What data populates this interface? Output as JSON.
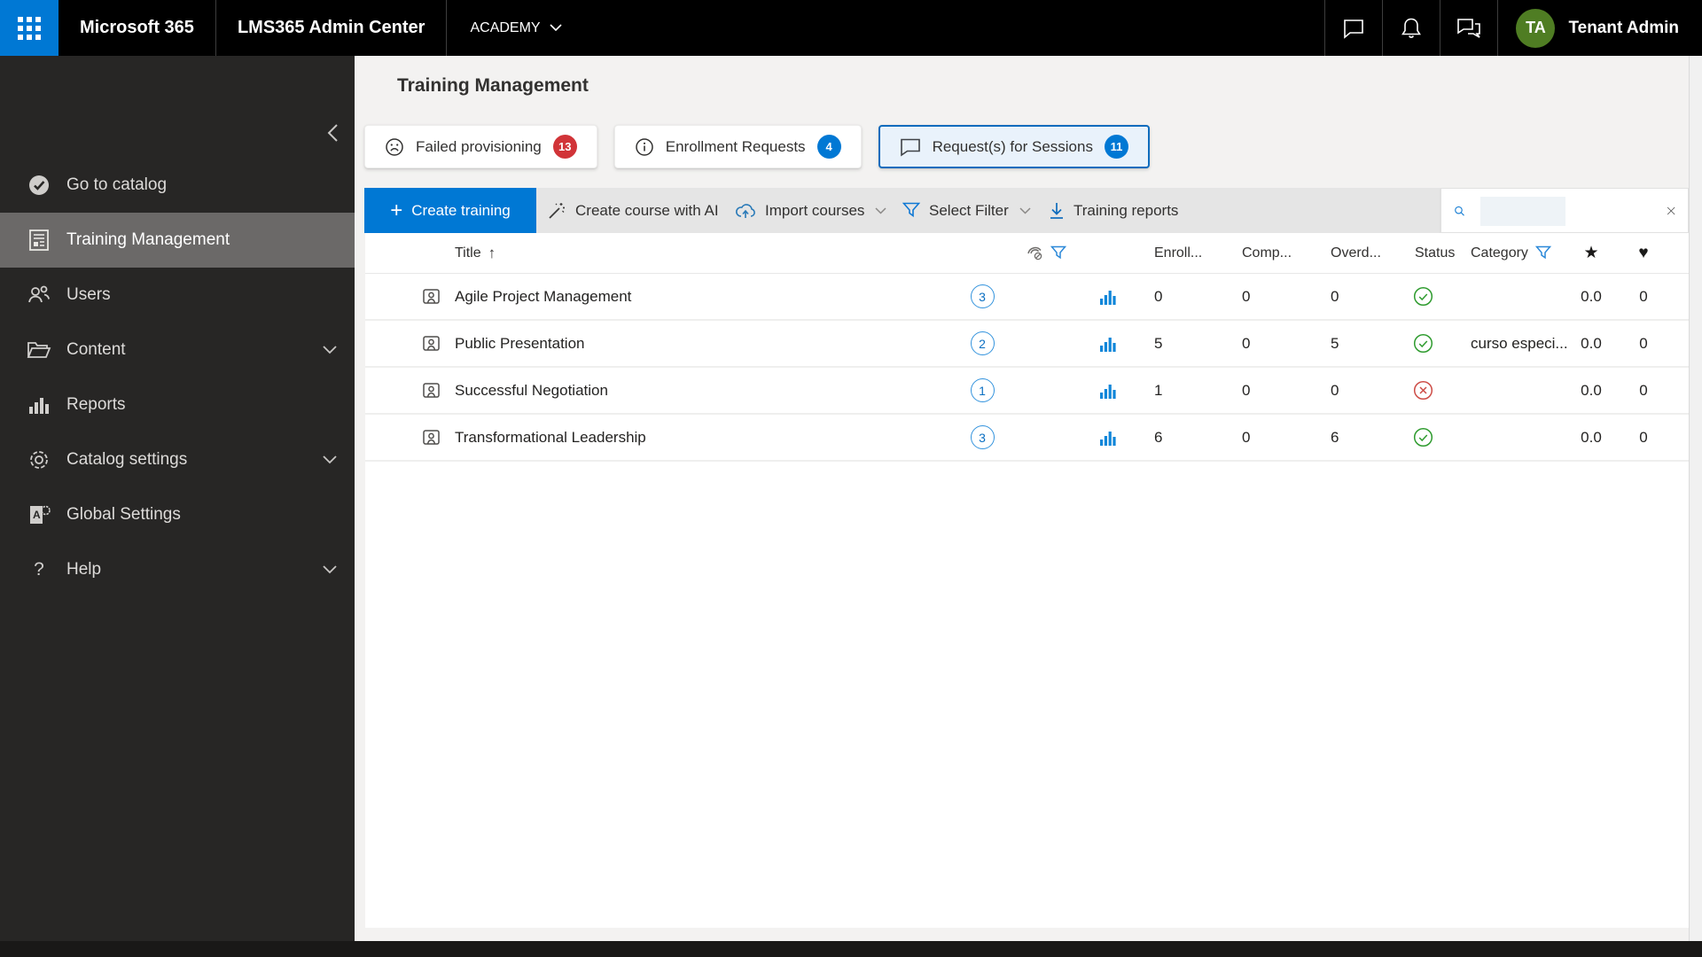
{
  "colors": {
    "accent": "#0078d4",
    "selected_tab_border": "#0f6cbd",
    "red_badge": "#d13438",
    "green_status": "#2e9b2e",
    "red_status": "#cd4c46",
    "avatar_bg": "#4f7d23",
    "topbar_bg": "#000000",
    "sidebar_bg": "#272625"
  },
  "topbar": {
    "product": "Microsoft 365",
    "app_title": "LMS365 Admin Center",
    "tenant_menu": "ACADEMY",
    "user_initials": "TA",
    "user_name": "Tenant Admin"
  },
  "sidebar": {
    "items": [
      {
        "label": "Go to catalog",
        "icon": "catalog-check",
        "expandable": false,
        "selected": false
      },
      {
        "label": "Training Management",
        "icon": "training-document",
        "expandable": false,
        "selected": true
      },
      {
        "label": "Users",
        "icon": "people",
        "expandable": false,
        "selected": false
      },
      {
        "label": "Content",
        "icon": "folder",
        "expandable": true,
        "selected": false
      },
      {
        "label": "Reports",
        "icon": "bar-chart",
        "expandable": false,
        "selected": false
      },
      {
        "label": "Catalog settings",
        "icon": "gear",
        "expandable": true,
        "selected": false
      },
      {
        "label": "Global Settings",
        "icon": "global-settings",
        "expandable": false,
        "selected": false
      },
      {
        "label": "Help",
        "icon": "question-mark",
        "expandable": true,
        "selected": false
      }
    ]
  },
  "page_title": "Training Management",
  "tabs": [
    {
      "label": "Failed provisioning",
      "count": "13",
      "icon": "sad-face",
      "badge": "red",
      "selected": false
    },
    {
      "label": "Enrollment Requests",
      "count": "4",
      "icon": "info-circle",
      "badge": "blue",
      "selected": false
    },
    {
      "label": "Request(s) for Sessions",
      "count": "11",
      "icon": "chat-bubble",
      "badge": "blue",
      "selected": true
    }
  ],
  "toolbar": {
    "create_training": "Create training",
    "create_course_ai": "Create course with AI",
    "import_courses": "Import courses",
    "select_filter": "Select Filter",
    "training_reports": "Training reports",
    "search_value": ""
  },
  "table": {
    "headers": {
      "title": "Title",
      "enrolled": "Enroll...",
      "completed": "Comp...",
      "overdue": "Overd...",
      "status": "Status",
      "category": "Category"
    },
    "rows": [
      {
        "title": "Agile Project Management",
        "sessions": "3",
        "enrolled": "0",
        "completed": "0",
        "overdue": "0",
        "status": "ok",
        "category": "",
        "rating": "0.0",
        "likes": "0"
      },
      {
        "title": "Public Presentation",
        "sessions": "2",
        "enrolled": "5",
        "completed": "0",
        "overdue": "5",
        "status": "ok",
        "category": "curso especi...",
        "rating": "0.0",
        "likes": "0"
      },
      {
        "title": "Successful Negotiation",
        "sessions": "1",
        "enrolled": "1",
        "completed": "0",
        "overdue": "0",
        "status": "failed",
        "category": "",
        "rating": "0.0",
        "likes": "0"
      },
      {
        "title": "Transformational Leadership",
        "sessions": "3",
        "enrolled": "6",
        "completed": "0",
        "overdue": "6",
        "status": "ok",
        "category": "",
        "rating": "0.0",
        "likes": "0"
      }
    ]
  },
  "icons": {
    "star": "★",
    "heart": "♥",
    "sort_asc": "↑",
    "plus": "+",
    "help": "?"
  }
}
